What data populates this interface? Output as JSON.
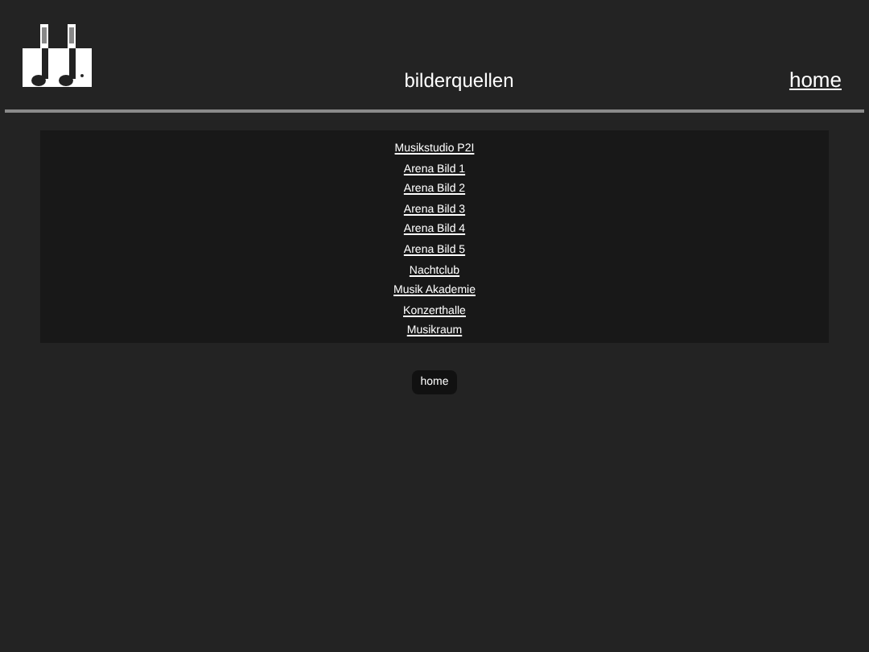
{
  "header": {
    "title": "bilderquellen",
    "nav_link": "home"
  },
  "sources": [
    "Musikstudio P2I",
    "Arena Bild 1",
    "Arena Bild 2",
    "Arena Bild 3",
    "Arena Bild 4",
    "Arena Bild 5",
    "Nachtclub",
    "Musik Akademie",
    "Konzerthalle",
    "Musikraum"
  ],
  "button": "home"
}
